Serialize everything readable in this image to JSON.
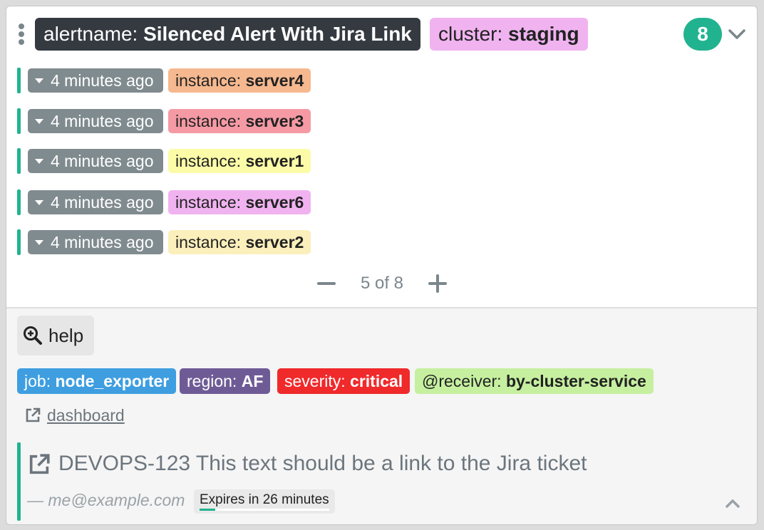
{
  "group": {
    "alertname_key": "alertname:",
    "alertname_value": "Silenced Alert With Jira Link",
    "cluster_key": "cluster:",
    "cluster_value": "staging",
    "count": "8",
    "colors": {
      "alertname_bg": "#343a40",
      "cluster_bg": "#f0b3f0",
      "count_bg": "#21b38f"
    }
  },
  "alerts": [
    {
      "time": "4 minutes ago",
      "label_key": "instance:",
      "label_value": "server4",
      "color": "#f5b88f"
    },
    {
      "time": "4 minutes ago",
      "label_key": "instance:",
      "label_value": "server3",
      "color": "#f59aa4"
    },
    {
      "time": "4 minutes ago",
      "label_key": "instance:",
      "label_value": "server1",
      "color": "#fbfba8"
    },
    {
      "time": "4 minutes ago",
      "label_key": "instance:",
      "label_value": "server6",
      "color": "#f0b3f0"
    },
    {
      "time": "4 minutes ago",
      "label_key": "instance:",
      "label_value": "server2",
      "color": "#fbefbb"
    }
  ],
  "pager": {
    "text": "5 of 8"
  },
  "footer": {
    "help_label": "help",
    "labels": [
      {
        "key": "job:",
        "value": "node_exporter",
        "color": "#3e9ee0"
      },
      {
        "key": "region:",
        "value": "AF",
        "color": "#6e5b96"
      },
      {
        "key": "severity:",
        "value": "critical",
        "color": "#f0292b"
      },
      {
        "key": "@receiver:",
        "value": "by-cluster-service",
        "color": "#c6f0a0"
      }
    ],
    "dashboard_link": "dashboard",
    "silence": {
      "jira_text": "DEVOPS-123 This text should be a link to the Jira ticket",
      "author": "— me@example.com",
      "expires": "Expires in 26 minutes",
      "progress_fraction": 0.12
    }
  },
  "icons": {
    "grip": "grip-vertical-icon",
    "collapse": "chevron-down-icon",
    "time_caret": "caret-down-icon",
    "pager_prev": "minus-icon",
    "pager_next": "plus-icon",
    "help": "search-plus-icon",
    "external": "external-link-icon",
    "expand": "chevron-up-icon"
  }
}
